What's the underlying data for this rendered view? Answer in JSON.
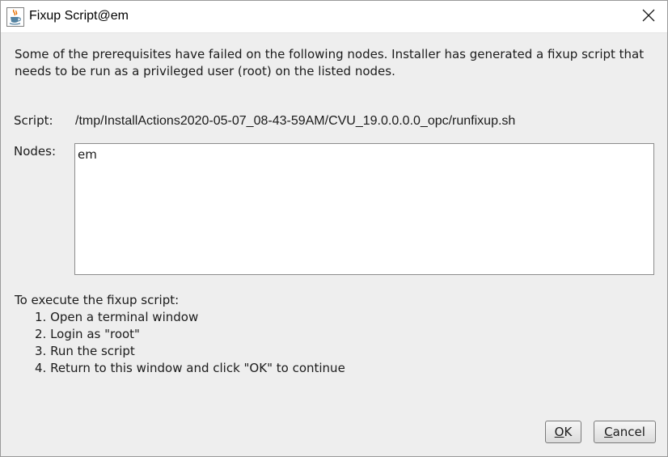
{
  "window": {
    "title": "Fixup Script@em",
    "icon": "java-cup-icon",
    "close_icon": "close-x-icon"
  },
  "message": "Some of the prerequisites have failed on the following nodes. Installer has generated a fixup script that needs to be run as a privileged user (root) on the listed nodes.",
  "script": {
    "label": "Script:",
    "path": "/tmp/InstallActions2020-05-07_08-43-59AM/CVU_19.0.0.0.0_opc/runfixup.sh"
  },
  "nodes": {
    "label": "Nodes:",
    "value": "em"
  },
  "instructions": {
    "heading": "To execute the fixup script:",
    "steps": [
      "1. Open a terminal window",
      "2. Login as \"root\"",
      "3. Run the script",
      "4. Return to this window and click \"OK\" to continue"
    ]
  },
  "buttons": {
    "ok": {
      "mnemonic": "O",
      "rest": "K"
    },
    "cancel": {
      "mnemonic": "C",
      "rest": "ancel"
    }
  },
  "colors": {
    "dialog_background": "#eeeeee",
    "titlebar_background": "#ffffff"
  }
}
